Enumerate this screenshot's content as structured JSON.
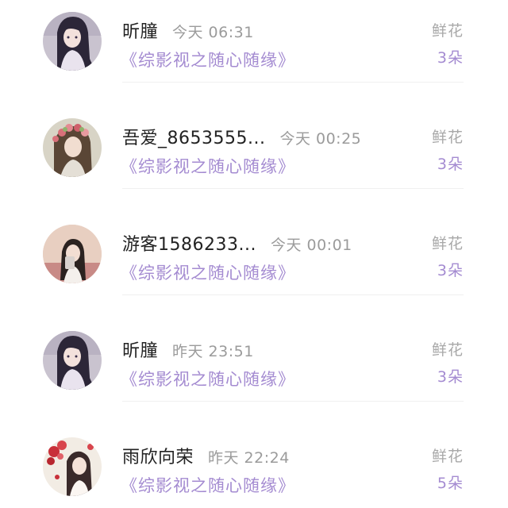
{
  "entries": [
    {
      "name": "昕朣",
      "time": "今天 06:31",
      "book": "《综影视之随心随缘》",
      "gift_label": "鲜花",
      "gift_count": "3朵",
      "avatar_icon": "anime-girl-dark-hair-avatar"
    },
    {
      "name": "吾爱_8653555...",
      "time": "今天 00:25",
      "book": "《综影视之随心随缘》",
      "gift_label": "鲜花",
      "gift_count": "3朵",
      "avatar_icon": "girl-flower-crown-avatar"
    },
    {
      "name": "游客1586233...",
      "time": "今天 00:01",
      "book": "《综影视之随心随缘》",
      "gift_label": "鲜花",
      "gift_count": "3朵",
      "avatar_icon": "girl-photo-avatar"
    },
    {
      "name": "昕朣",
      "time": "昨天 23:51",
      "book": "《综影视之随心随缘》",
      "gift_label": "鲜花",
      "gift_count": "3朵",
      "avatar_icon": "anime-girl-dark-hair-avatar"
    },
    {
      "name": "雨欣向荣",
      "time": "昨天 22:24",
      "book": "《综影视之随心随缘》",
      "gift_label": "鲜花",
      "gift_count": "5朵",
      "avatar_icon": "girl-red-flowers-avatar"
    }
  ],
  "colors": {
    "accent_purple": "#a48bd1",
    "name_text": "#222222",
    "muted_text": "#9b9b9b",
    "divider": "#f0f0f0"
  }
}
